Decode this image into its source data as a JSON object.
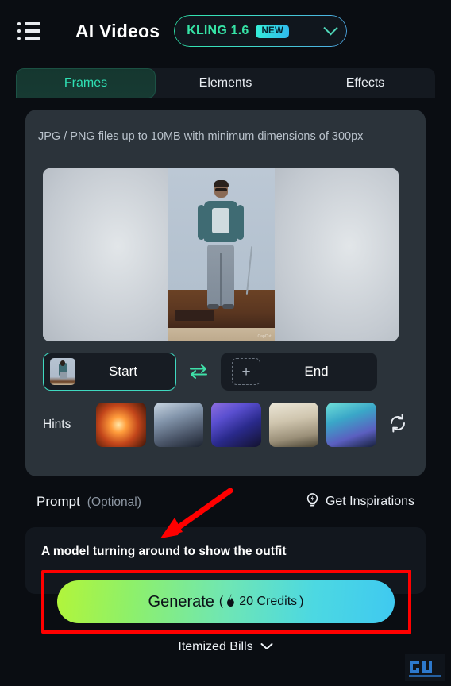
{
  "header": {
    "menu_icon": "list-menu-icon",
    "title": "AI Videos",
    "model": {
      "name": "KLING 1.6",
      "badge": "NEW",
      "chevron_icon": "chevron-down-icon"
    }
  },
  "tabs": [
    {
      "label": "Frames",
      "active": true
    },
    {
      "label": "Elements",
      "active": false
    },
    {
      "label": "Effects",
      "active": false
    }
  ],
  "upload": {
    "hint": "JPG / PNG files up to 10MB with minimum dimensions of 300px",
    "preview_watermark": "CapCut"
  },
  "frames": {
    "start_label": "Start",
    "end_label": "End",
    "swap_icon": "swap-arrows-icon",
    "add_icon": "plus-icon"
  },
  "hints": {
    "label": "Hints",
    "refresh_icon": "refresh-icon",
    "thumbnails": [
      "hint-fire-creature",
      "hint-winter-warrior",
      "hint-purple-dragon",
      "hint-girl-with-lion",
      "hint-underwater-mermaid"
    ]
  },
  "prompt": {
    "title": "Prompt",
    "optional": "(Optional)",
    "inspirations_label": "Get Inspirations",
    "inspirations_icon": "lightbulb-bolt-icon",
    "value": "A model turning around to show the outfit",
    "placeholder": "A model turning around to show the outfit"
  },
  "generate": {
    "label": "Generate",
    "credits_open": "(",
    "credits_icon": "flame-icon",
    "credits_text": "20 Credits",
    "credits_close": ")"
  },
  "bills": {
    "label": "Itemized Bills",
    "chevron_icon": "chevron-down-icon"
  },
  "annotations": {
    "highlight_color": "#ff0000",
    "arrow_target": "prompt-input",
    "box_target": "generate-button"
  },
  "watermark": {
    "text": "GT"
  },
  "colors": {
    "accent_teal": "#36e3a6",
    "page_bg": "#0a0d12",
    "panel_bg": "#2b333a",
    "gen_gradient_start": "#b2f53a",
    "gen_gradient_end": "#3fc9f0"
  }
}
